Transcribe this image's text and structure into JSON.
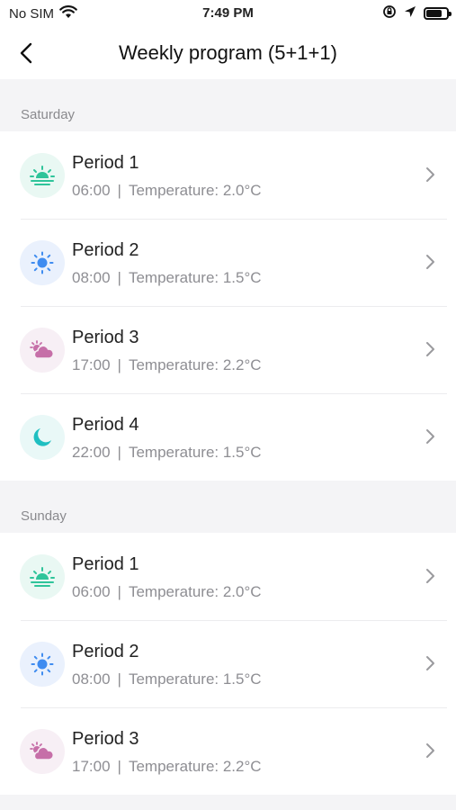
{
  "status": {
    "carrier": "No SIM",
    "time": "7:49 PM"
  },
  "nav": {
    "title": "Weekly program (5+1+1)"
  },
  "sections": [
    {
      "day": "Saturday",
      "periods": [
        {
          "label": "Period 1",
          "time": "06:00",
          "temperature": "Temperature: 2.0°C",
          "icon": "sunrise-icon"
        },
        {
          "label": "Period 2",
          "time": "08:00",
          "temperature": "Temperature: 1.5°C",
          "icon": "sun-icon"
        },
        {
          "label": "Period 3",
          "time": "17:00",
          "temperature": "Temperature: 2.2°C",
          "icon": "cloudy-evening-icon"
        },
        {
          "label": "Period 4",
          "time": "22:00",
          "temperature": "Temperature: 1.5°C",
          "icon": "moon-icon"
        }
      ]
    },
    {
      "day": "Sunday",
      "periods": [
        {
          "label": "Period 1",
          "time": "06:00",
          "temperature": "Temperature: 2.0°C",
          "icon": "sunrise-icon"
        },
        {
          "label": "Period 2",
          "time": "08:00",
          "temperature": "Temperature: 1.5°C",
          "icon": "sun-icon"
        },
        {
          "label": "Period 3",
          "time": "17:00",
          "temperature": "Temperature: 2.2°C",
          "icon": "cloudy-evening-icon"
        }
      ]
    }
  ],
  "separator": "|",
  "colors": {
    "sunrise": "#2fc49a",
    "sun": "#3f8cf0",
    "cloud": "#c66fa8",
    "moon": "#1fbfc1"
  }
}
